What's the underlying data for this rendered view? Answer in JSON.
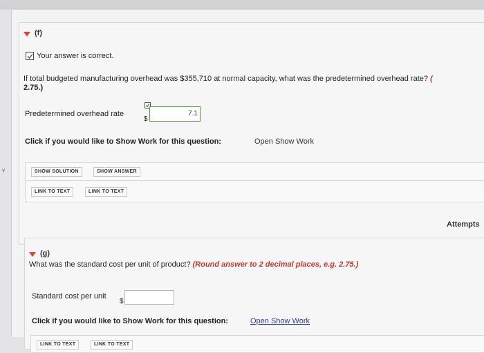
{
  "part_f": {
    "label": "(f)",
    "status": "Your answer is correct.",
    "question_prefix": "If total budgeted manufacturing overhead was $355,710 at normal capacity, what was the predetermined overhead rate?",
    "question_hint_tail": "(",
    "question_hint_line2": "2.75.)",
    "field_label": "Predetermined overhead rate",
    "currency": "$",
    "answer_value": "7.1",
    "show_work_prompt": "Click if you would like to Show Work for this question:",
    "show_work_link": "Open Show Work",
    "buttons": {
      "show_solution": "SHOW SOLUTION",
      "show_answer": "SHOW ANSWER",
      "link_to_text_1": "LINK TO TEXT",
      "link_to_text_2": "LINK TO TEXT"
    },
    "attempts_label": "Attempts"
  },
  "part_g": {
    "label": "(g)",
    "question": "What was the standard cost per unit of product?",
    "hint": "(Round answer to 2 decimal places, e.g. 2.75.)",
    "field_label": "Standard cost per unit",
    "currency": "$",
    "answer_value": "",
    "show_work_prompt": "Click if you would like to Show Work for this question:",
    "show_work_link": "Open Show Work",
    "buttons": {
      "link_to_text_1": "LINK TO TEXT",
      "link_to_text_2": "LINK TO TEXT"
    }
  },
  "left_margin_mark": "v",
  "colors": {
    "caret": "#e0433a",
    "correct_border": "#4a9a3f",
    "hint_red": "#c0392b",
    "link_blue": "#2a3a8a"
  },
  "icons": {
    "caret": "caret-down-icon",
    "check": "check-icon"
  }
}
